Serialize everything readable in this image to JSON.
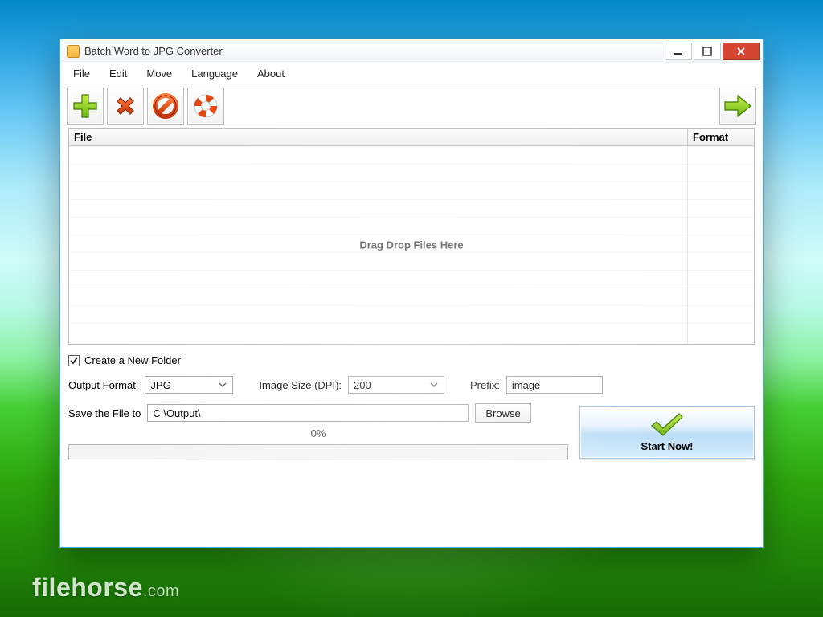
{
  "window": {
    "title": "Batch Word to JPG Converter"
  },
  "menubar": {
    "items": [
      "File",
      "Edit",
      "Move",
      "Language",
      "About"
    ]
  },
  "list": {
    "headers": {
      "file": "File",
      "format": "Format"
    },
    "placeholder": "Drag  Drop Files Here"
  },
  "options": {
    "create_folder_checked": true,
    "create_folder_label": "Create a New Folder",
    "output_format_label": "Output Format:",
    "output_format_value": "JPG",
    "dpi_label": "Image Size (DPI):",
    "dpi_value": "200",
    "prefix_label": "Prefix:",
    "prefix_value": "image",
    "save_label": "Save the File to",
    "save_path": "C:\\Output\\",
    "browse_label": "Browse"
  },
  "progress": {
    "percent_text": "0%"
  },
  "start": {
    "label": "Start Now!"
  },
  "watermark": {
    "name": "filehorse",
    "tld": ".com"
  }
}
